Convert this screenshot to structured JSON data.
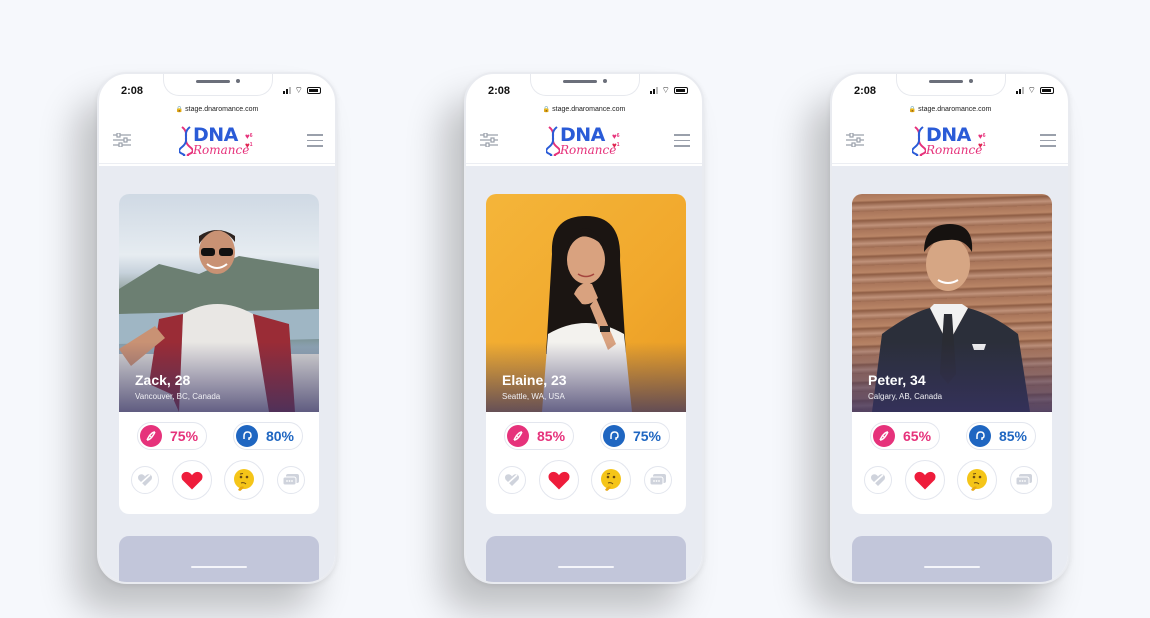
{
  "brand": {
    "logo_top": "DNA",
    "logo_bottom": "Romance",
    "likes_count": "6",
    "matches_count": "1",
    "colors": {
      "pink": "#e6327b",
      "blue": "#1f66c1",
      "navy": "#2a5bd7"
    }
  },
  "statusbar": {
    "time": "2:08"
  },
  "browser": {
    "url": "stage.dnaromance.com"
  },
  "icons": {
    "filter": "filter-sliders-icon",
    "menu": "hamburger-menu-icon",
    "dna": "dna-icon",
    "brain": "brain-icon",
    "pass": "pass-heart-icon",
    "like": "heart-icon",
    "curious": "thinking-face-icon",
    "message": "chat-icon"
  },
  "profiles": [
    {
      "name_age": "Zack, 28",
      "location": "Vancouver, BC, Canada",
      "dna_score": "75%",
      "brain_score": "80%"
    },
    {
      "name_age": "Elaine, 23",
      "location": "Seattle, WA, USA",
      "dna_score": "85%",
      "brain_score": "75%"
    },
    {
      "name_age": "Peter, 34",
      "location": "Calgary, AB, Canada",
      "dna_score": "65%",
      "brain_score": "85%"
    }
  ]
}
